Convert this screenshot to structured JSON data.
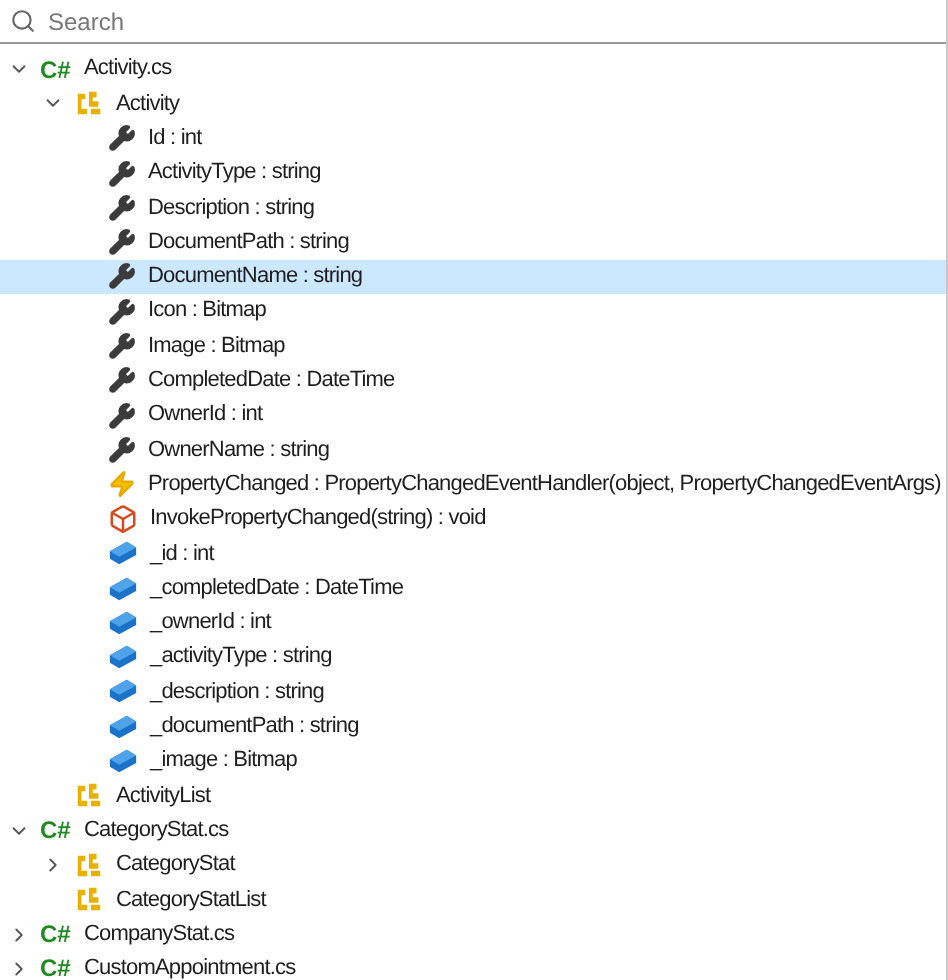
{
  "search": {
    "placeholder": "Search"
  },
  "tree": [
    {
      "kind": "file",
      "icon_text": "C#",
      "label": "Activity.cs",
      "selected": false,
      "expanded": true,
      "children": [
        {
          "kind": "class",
          "label": "Activity",
          "selected": false,
          "expanded": true,
          "children": [
            {
              "kind": "property",
              "label": "Id : int",
              "selected": false
            },
            {
              "kind": "property",
              "label": "ActivityType : string",
              "selected": false
            },
            {
              "kind": "property",
              "label": "Description : string",
              "selected": false
            },
            {
              "kind": "property",
              "label": "DocumentPath : string",
              "selected": false
            },
            {
              "kind": "property",
              "label": "DocumentName : string",
              "selected": true
            },
            {
              "kind": "property",
              "label": "Icon : Bitmap",
              "selected": false
            },
            {
              "kind": "property",
              "label": "Image : Bitmap",
              "selected": false
            },
            {
              "kind": "property",
              "label": "CompletedDate : DateTime",
              "selected": false
            },
            {
              "kind": "property",
              "label": "OwnerId : int",
              "selected": false
            },
            {
              "kind": "property",
              "label": "OwnerName : string",
              "selected": false
            },
            {
              "kind": "event",
              "label": "PropertyChanged : PropertyChangedEventHandler(object, PropertyChangedEventArgs)",
              "selected": false
            },
            {
              "kind": "method",
              "label": "InvokePropertyChanged(string) : void",
              "selected": false
            },
            {
              "kind": "field",
              "label": "_id : int",
              "selected": false
            },
            {
              "kind": "field",
              "label": "_completedDate : DateTime",
              "selected": false
            },
            {
              "kind": "field",
              "label": "_ownerId : int",
              "selected": false
            },
            {
              "kind": "field",
              "label": "_activityType : string",
              "selected": false
            },
            {
              "kind": "field",
              "label": "_description : string",
              "selected": false
            },
            {
              "kind": "field",
              "label": "_documentPath : string",
              "selected": false
            },
            {
              "kind": "field",
              "label": "_image : Bitmap",
              "selected": false
            }
          ]
        },
        {
          "kind": "class",
          "label": "ActivityList",
          "selected": false
        }
      ]
    },
    {
      "kind": "file",
      "icon_text": "C#",
      "label": "CategoryStat.cs",
      "selected": false,
      "expanded": true,
      "children": [
        {
          "kind": "class",
          "label": "CategoryStat",
          "selected": false,
          "expanded": false
        },
        {
          "kind": "class",
          "label": "CategoryStatList",
          "selected": false
        }
      ]
    },
    {
      "kind": "file",
      "icon_text": "C#",
      "label": "CompanyStat.cs",
      "selected": false,
      "expanded": false
    },
    {
      "kind": "file",
      "icon_text": "C#",
      "label": "CustomAppointment.cs",
      "selected": false,
      "expanded": false
    }
  ]
}
